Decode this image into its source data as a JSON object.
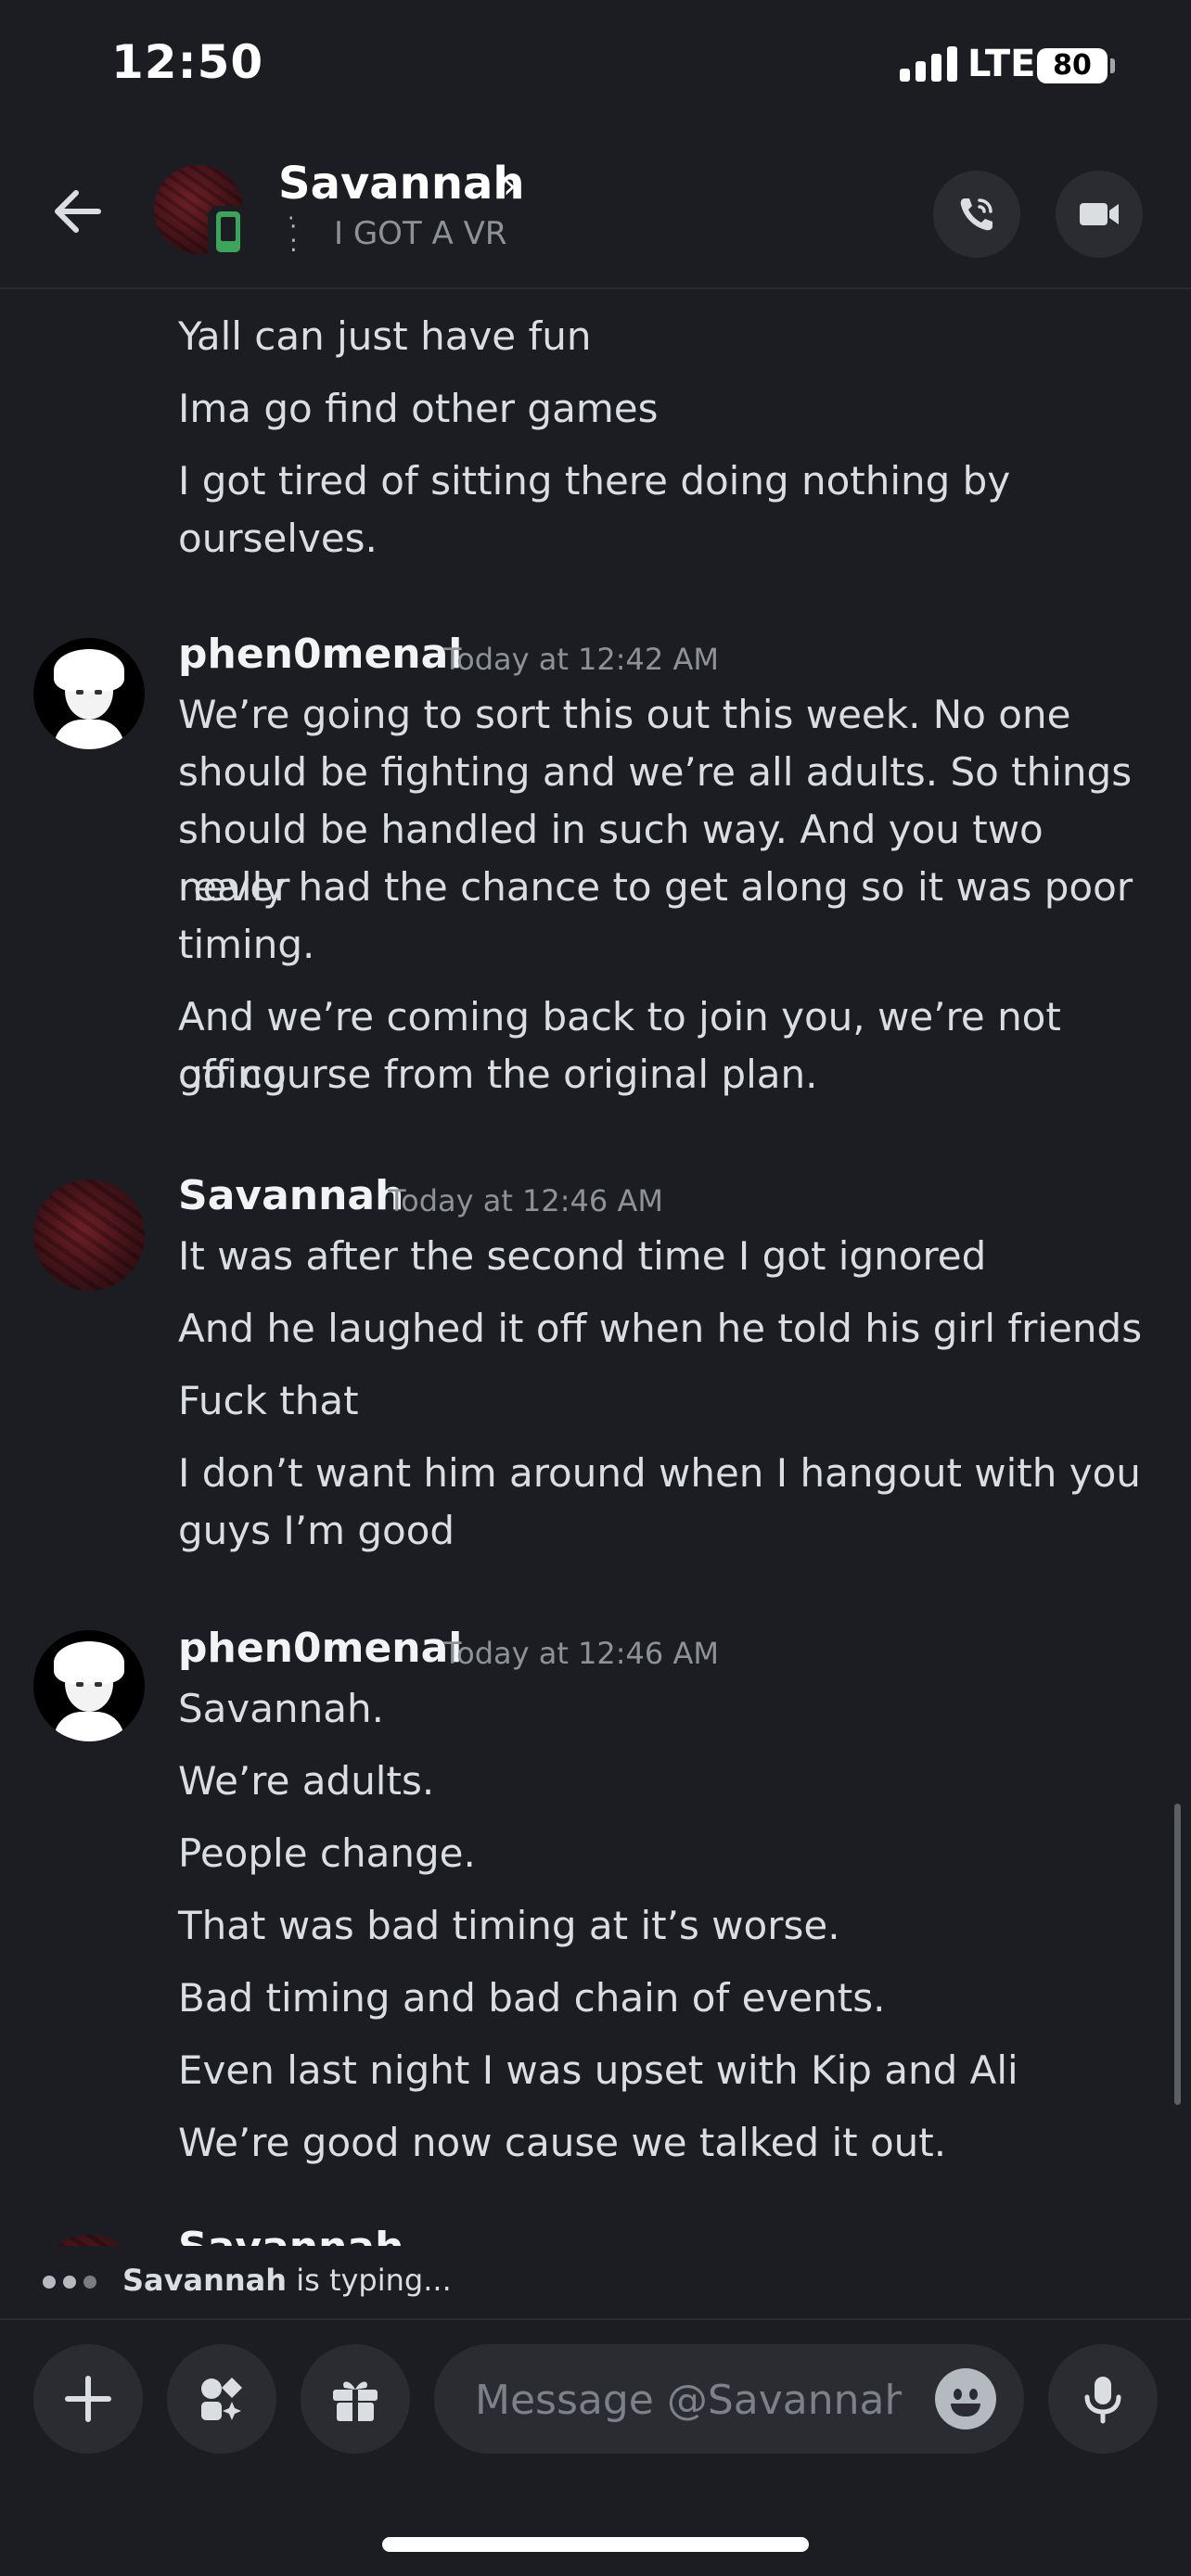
{
  "status_bar": {
    "time": "12:50",
    "network": "LTE",
    "battery": "80"
  },
  "header": {
    "name": "Savannah",
    "chevron": "›",
    "custom_status": "I GOT A VR",
    "call_icon": "phone-call-icon",
    "video_icon": "video-camera-icon"
  },
  "messages": {
    "group0": {
      "lines": [
        "Yall can just have fun",
        "Ima go find other games",
        "I got tired of sitting there doing nothing by",
        "ourselves."
      ]
    },
    "group1": {
      "author": "phen0menal",
      "timestamp": "Today at 12:42 AM",
      "lines": [
        "We’re going to sort this out this week. No one",
        "should be fighting and we’re all adults. So things",
        "should be handled in such way. And you two never",
        "really had the chance to get along so it was poor",
        "timing.",
        "And we’re coming back to join you, we’re not going",
        "off course from the original plan."
      ]
    },
    "group2": {
      "author": "Savannah",
      "timestamp": "Today at 12:46 AM",
      "lines": [
        "It was after the second time I got ignored",
        "And he laughed it off when he told his girl friends",
        "Fuck that",
        "I don’t want him around when I hangout with you",
        "guys I’m good"
      ]
    },
    "group3": {
      "author": "phen0menal",
      "timestamp": "Today at 12:46 AM",
      "lines": [
        "Savannah.",
        "We’re adults.",
        "People change.",
        "That was bad timing at it’s worse.",
        "Bad timing and bad chain of events.",
        "Even last night I was upset with Kip and Ali",
        "We’re good now cause we talked it out."
      ]
    },
    "partial_author": "Savannah"
  },
  "typing": {
    "user": "Savannah",
    "suffix": " is typing..."
  },
  "composer": {
    "placeholder": "Message @Savannah"
  }
}
